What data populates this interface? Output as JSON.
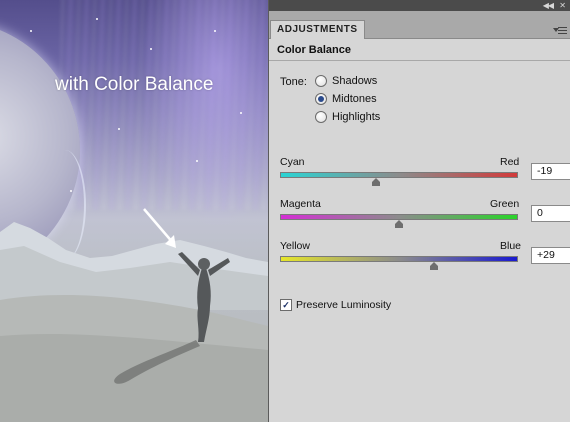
{
  "artwork": {
    "caption": "with Color Balance"
  },
  "panel": {
    "tab_label": "ADJUSTMENTS",
    "title": "Color Balance",
    "tone": {
      "label": "Tone:",
      "options": [
        "Shadows",
        "Midtones",
        "Highlights"
      ],
      "selected": "Midtones"
    },
    "sliders": [
      {
        "left_label": "Cyan",
        "right_label": "Red",
        "value": "-19",
        "min": -100,
        "max": 100,
        "left_color": "#29d4d4",
        "right_color": "#d23a3a"
      },
      {
        "left_label": "Magenta",
        "right_label": "Green",
        "value": "0",
        "min": -100,
        "max": 100,
        "left_color": "#d42ed4",
        "right_color": "#2ad42a"
      },
      {
        "left_label": "Yellow",
        "right_label": "Blue",
        "value": "+29",
        "min": -100,
        "max": 100,
        "left_color": "#e6e62a",
        "right_color": "#1a1ad0"
      }
    ],
    "preserve_luminosity": {
      "label": "Preserve Luminosity",
      "checked": true
    }
  },
  "icons": {
    "collapse": "double-chevron-right-icon",
    "close": "close-icon",
    "panel_menu": "panel-menu-icon",
    "arrow": "white-arrow-icon"
  }
}
